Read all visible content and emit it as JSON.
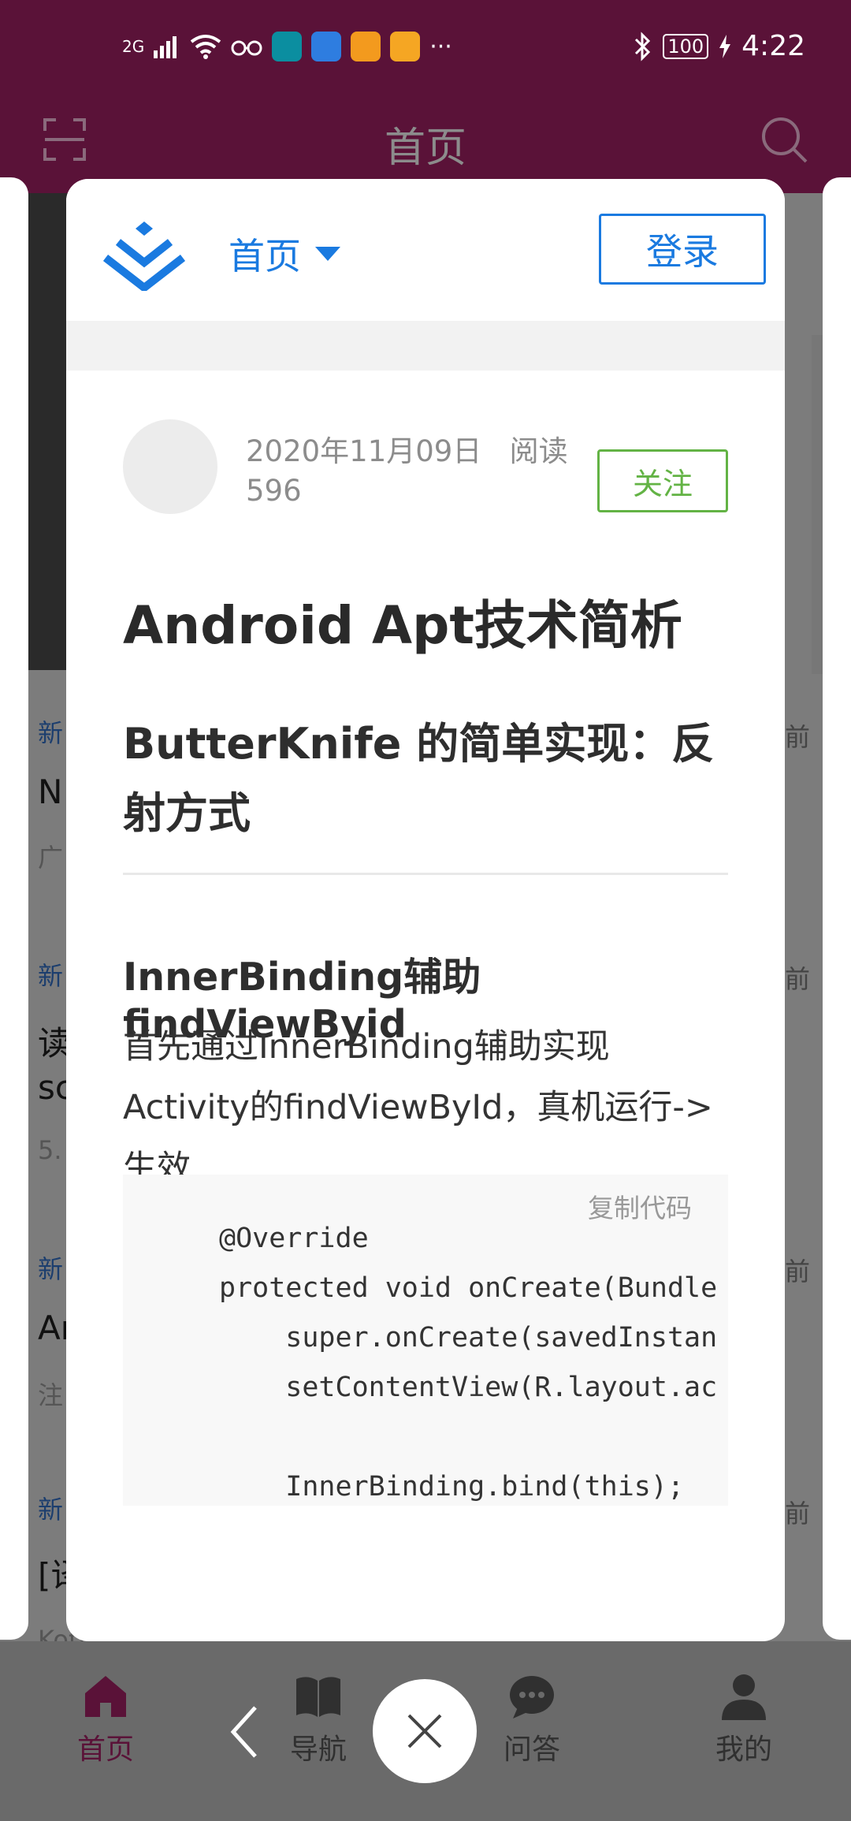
{
  "status_bar": {
    "network": "2G",
    "more": "···",
    "battery": "100",
    "time": "4:22"
  },
  "app_bar": {
    "title": "首页"
  },
  "background_fragments": [
    "新",
    "N",
    "广",
    "新",
    "读",
    "sc",
    "5.",
    "新",
    "Ar",
    "注",
    "新",
    "[译",
    "Kotlin 入门及知识点",
    "前",
    "前",
    "前",
    "前"
  ],
  "modal": {
    "nav_label": "首页",
    "login_label": "登录",
    "meta_date": "2020年11月09日",
    "meta_read_label": "阅读",
    "meta_read_count": "596",
    "follow_label": "关注",
    "article_title": "Android Apt技术简析",
    "heading2": "ButterKnife 的简单实现：反射方式",
    "heading3": "InnerBinding辅助findViewByid",
    "paragraph": "首先通过InnerBinding辅助实现Activity的findViewById，真机运行->生效",
    "copy_code_label": "复制代码",
    "code": "@Override\nprotected void onCreate(Bundle\n    super.onCreate(savedInstan\n    setContentView(R.layout.ac\n\n    InnerBinding.bind(this);"
  },
  "bottom_nav": {
    "home": "首页",
    "nav": "导航",
    "qa": "问答",
    "mine": "我的"
  },
  "colors": {
    "brand": "#5a1238",
    "link_blue": "#1a7ae0",
    "follow_green": "#63b345"
  }
}
